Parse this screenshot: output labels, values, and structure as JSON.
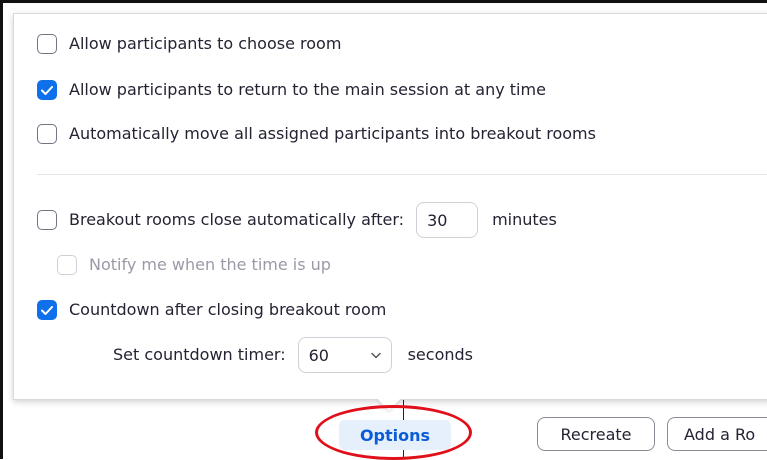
{
  "options": {
    "allow_choose_room": {
      "label": "Allow participants to choose room",
      "checked": false
    },
    "allow_return_main": {
      "label": "Allow participants to return to the main session at any time",
      "checked": true
    },
    "auto_move": {
      "label": "Automatically move all assigned participants into breakout rooms",
      "checked": false
    },
    "auto_close": {
      "label": "Breakout rooms close automatically after:",
      "checked": false,
      "value": "30",
      "unit": "minutes"
    },
    "notify": {
      "label": "Notify me when the time is up",
      "checked": false,
      "disabled": true
    },
    "countdown": {
      "label": "Countdown after closing breakout room",
      "checked": true
    },
    "countdown_timer": {
      "label": "Set countdown timer:",
      "value": "60",
      "unit": "seconds"
    }
  },
  "footer": {
    "options_label": "Options",
    "recreate_label": "Recreate",
    "add_room_label": "Add a Ro"
  },
  "colors": {
    "accent": "#0e71eb",
    "options_text": "#0b5cd7",
    "highlight": "#e0101b"
  }
}
